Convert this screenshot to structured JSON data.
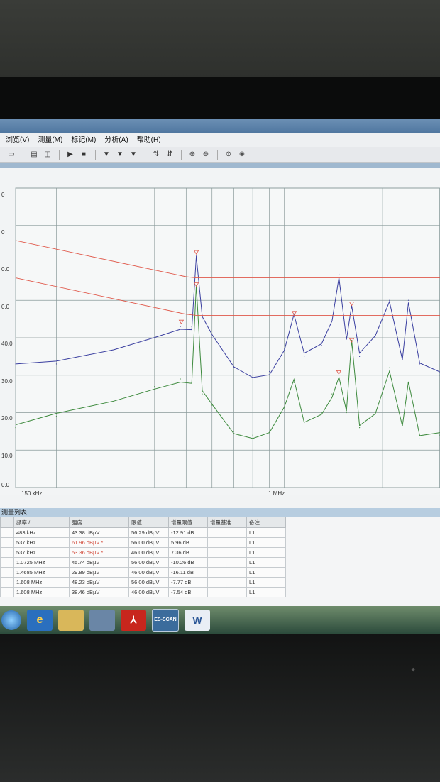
{
  "menu": {
    "items": [
      "浏览(V)",
      "测量(M)",
      "标记(M)",
      "分析(A)",
      "帮助(H)"
    ]
  },
  "chart": {
    "y_ticks": [
      "0",
      "0",
      "0.0",
      "0.0",
      "40.0",
      "30.0",
      "20.0",
      "10.0",
      "0.0"
    ],
    "x_start_label": "150 kHz",
    "x_mid_label": "1 MHz"
  },
  "chart_data": {
    "type": "line",
    "ylim": [
      0,
      80
    ],
    "xaxis": "log",
    "xlim_hz": [
      150000,
      3000000
    ],
    "series": [
      {
        "x_mhz": [
          0.15,
          0.2,
          0.3,
          0.4,
          0.48,
          0.52,
          0.537,
          0.56,
          0.6,
          0.7,
          0.8,
          0.9,
          1.0,
          1.07,
          1.15,
          1.3,
          1.4,
          1.47,
          1.55,
          1.608,
          1.7,
          1.9,
          2.1,
          2.3,
          2.4,
          2.6,
          3.0
        ],
        "values": [
          33,
          33,
          36,
          40,
          43,
          43,
          61.96,
          45,
          40,
          32,
          30,
          31,
          37,
          45.7,
          35,
          38,
          45,
          57,
          40,
          48.2,
          35,
          40,
          50,
          35,
          50,
          33,
          30
        ]
      },
      {
        "x_mhz": [
          0.15,
          0.2,
          0.3,
          0.4,
          0.48,
          0.52,
          0.537,
          0.56,
          0.6,
          0.7,
          0.8,
          0.9,
          1.0,
          1.07,
          1.15,
          1.3,
          1.4,
          1.47,
          1.55,
          1.608,
          1.7,
          1.9,
          2.1,
          2.3,
          2.4,
          2.6,
          3.0
        ],
        "values": [
          16,
          19,
          23,
          27,
          29,
          28,
          53.36,
          25,
          22,
          15,
          14,
          15,
          21,
          28,
          17,
          20,
          25,
          30,
          20,
          38.5,
          16,
          20,
          32,
          17,
          28,
          13,
          14
        ]
      },
      {
        "x_mhz": [
          0.15,
          0.5,
          0.537,
          3.0
        ],
        "values": [
          66,
          56.3,
          56,
          56
        ]
      },
      {
        "x_mhz": [
          0.15,
          0.5,
          0.537,
          3.0
        ],
        "values": [
          56,
          46.3,
          46,
          46
        ]
      }
    ]
  },
  "table": {
    "title": "测量列表",
    "headers": [
      "频率 /",
      "强度",
      "限值",
      "增量限值",
      "增量基准",
      "备注"
    ],
    "rows": [
      [
        "483 kHz",
        "43.38 dBµV",
        "56.29 dBµV",
        "-12.91 dB",
        "",
        "L1"
      ],
      [
        "537 kHz",
        "61.96 dBµV *",
        "56.00 dBµV",
        "5.96 dB",
        "",
        "L1"
      ],
      [
        "537 kHz",
        "53.36 dBµV *",
        "46.00 dBµV",
        "7.36 dB",
        "",
        "L1"
      ],
      [
        "1.0725 MHz",
        "45.74 dBµV",
        "56.00 dBµV",
        "-10.26 dB",
        "",
        "L1"
      ],
      [
        "1.4685 MHz",
        "29.89 dBµV",
        "46.00 dBµV",
        "-16.11 dB",
        "",
        "L1"
      ],
      [
        "1.608 MHz",
        "48.23 dBµV",
        "56.00 dBµV",
        "-7.77 dB",
        "",
        "L1"
      ],
      [
        "1.608 MHz",
        "38.46 dBµV",
        "46.00 dBµV",
        "-7.54 dB",
        "",
        "L1"
      ]
    ]
  },
  "taskbar": {
    "icons": [
      "start-orb-icon",
      "ie-icon",
      "folder-icon",
      "network-icon",
      "acrobat-icon",
      "es-scan-icon",
      "word-icon"
    ],
    "scan_label": "ES-SCAN",
    "word_label": "W"
  },
  "colors": {
    "upper_trace": "#3a3fa0",
    "lower_trace": "#3d8a3d",
    "limit": "#e0584a"
  }
}
